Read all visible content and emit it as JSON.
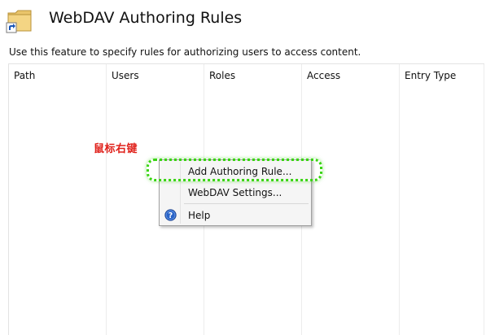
{
  "header": {
    "title": "WebDAV Authoring Rules",
    "icon": "folder-shortcut-icon",
    "description": "Use this feature to specify rules for authorizing users to access content."
  },
  "table": {
    "columns": [
      "Path",
      "Users",
      "Roles",
      "Access",
      "Entry Type"
    ],
    "rows": []
  },
  "annotation": {
    "text": "鼠标右键",
    "color": "#e0201a"
  },
  "context_menu": {
    "items": [
      {
        "label": "Add Authoring Rule...",
        "highlighted": true
      },
      {
        "label": "WebDAV Settings...",
        "highlighted": false
      },
      {
        "label": "Help",
        "icon": "help-icon",
        "highlighted": false
      }
    ]
  },
  "colors": {
    "highlight_border": "#39d412",
    "menu_background": "#f5f5f5",
    "help_icon": "#2a64c8"
  }
}
